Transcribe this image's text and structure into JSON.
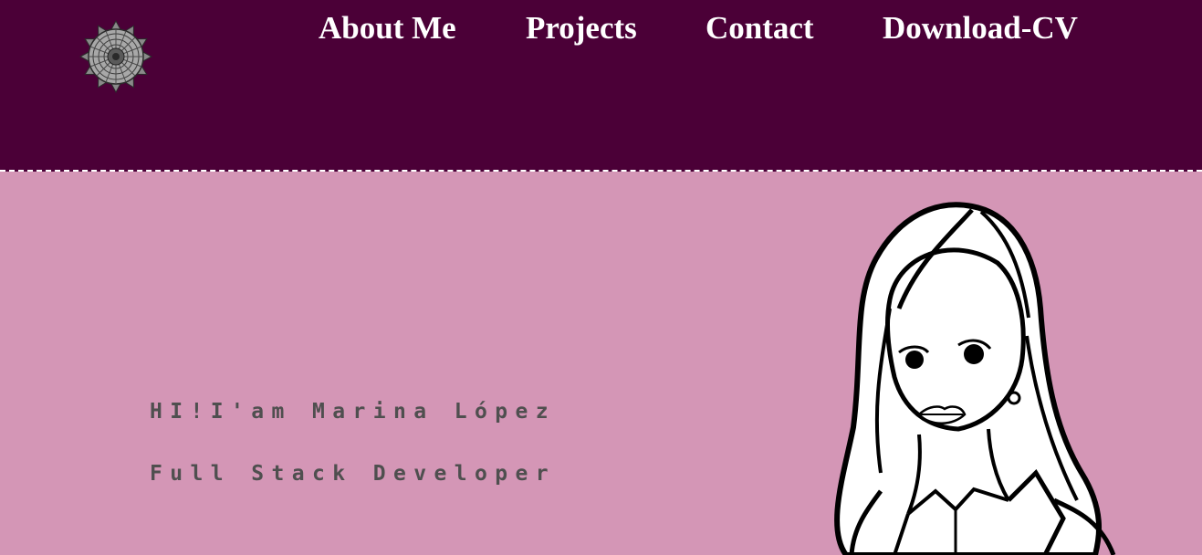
{
  "header": {
    "logo_icon": "mandala-logo-icon",
    "nav": [
      {
        "label": "About Me"
      },
      {
        "label": "Projects"
      },
      {
        "label": "Contact"
      },
      {
        "label": "Download-CV"
      }
    ]
  },
  "hero": {
    "greeting": "HI!I'am Marina López",
    "role": "Full Stack Developer",
    "portrait_icon": "woman-portrait-illustration"
  },
  "colors": {
    "header_bg": "#4b0037",
    "hero_bg": "#d496b6",
    "nav_text": "#ffffff",
    "hero_text": "#4f4f4f"
  }
}
